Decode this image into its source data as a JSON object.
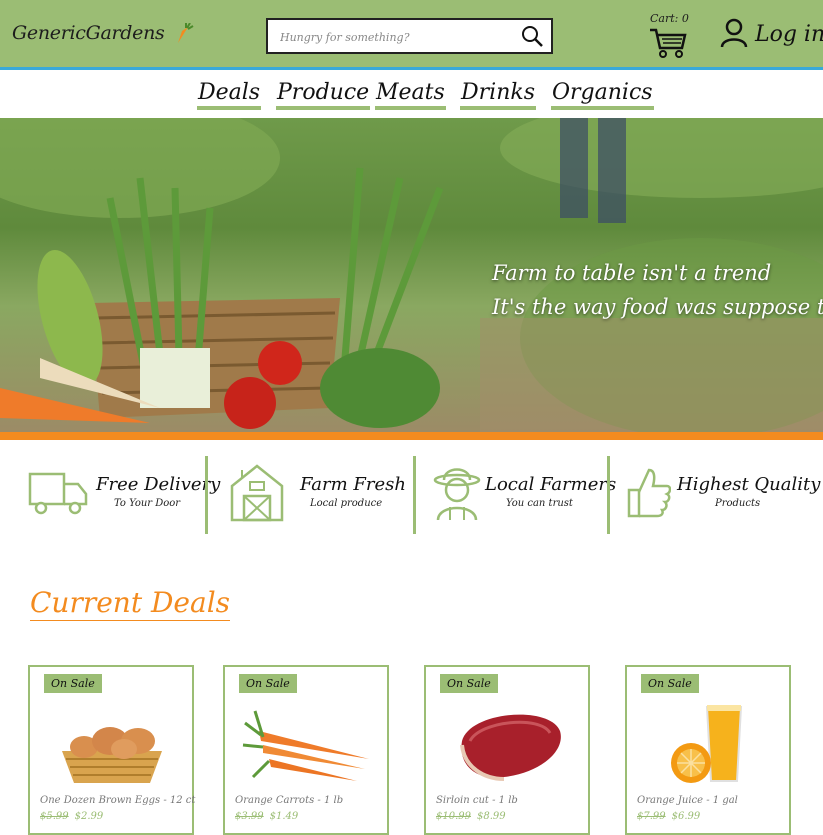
{
  "header": {
    "logo": "GenericGardens",
    "search_placeholder": "Hungry for something?",
    "cart_label": "Cart: 0",
    "login_label": "Log in"
  },
  "nav": {
    "items": [
      "Deals",
      "Produce",
      "Meats",
      "Drinks",
      "Organics"
    ]
  },
  "hero": {
    "line1": "Farm to table isn't a trend",
    "line2": "It's the way food was suppose to be"
  },
  "features": [
    {
      "title": "Free Delivery",
      "subtitle": "To Your Door",
      "icon": "truck-icon"
    },
    {
      "title": "Farm Fresh",
      "subtitle": "Local produce",
      "icon": "barn-icon"
    },
    {
      "title": "Local Farmers",
      "subtitle": "You can trust",
      "icon": "farmer-icon"
    },
    {
      "title": "Highest Quality",
      "subtitle": "Products",
      "icon": "thumbs-up-icon"
    }
  ],
  "deals": {
    "title": "Current Deals",
    "cards": [
      {
        "badge": "On Sale",
        "name": "One Dozen Brown Eggs - 12 ct",
        "old_price": "$5.99",
        "new_price": "$2.99",
        "image": "eggs-image"
      },
      {
        "badge": "On Sale",
        "name": "Orange Carrots - 1 lb",
        "old_price": "$3.99",
        "new_price": "$1.49",
        "image": "carrots-image"
      },
      {
        "badge": "On Sale",
        "name": "Sirloin cut - 1 lb",
        "old_price": "$10.99",
        "new_price": "$8.99",
        "image": "steak-image"
      },
      {
        "badge": "On Sale",
        "name": "Orange Juice - 1 gal",
        "old_price": "$7.99",
        "new_price": "$6.99",
        "image": "orange-juice-image"
      }
    ]
  },
  "colors": {
    "header_green": "#9bbd74",
    "accent_orange": "#f38b1f",
    "header_border_blue": "#39a9d9"
  }
}
